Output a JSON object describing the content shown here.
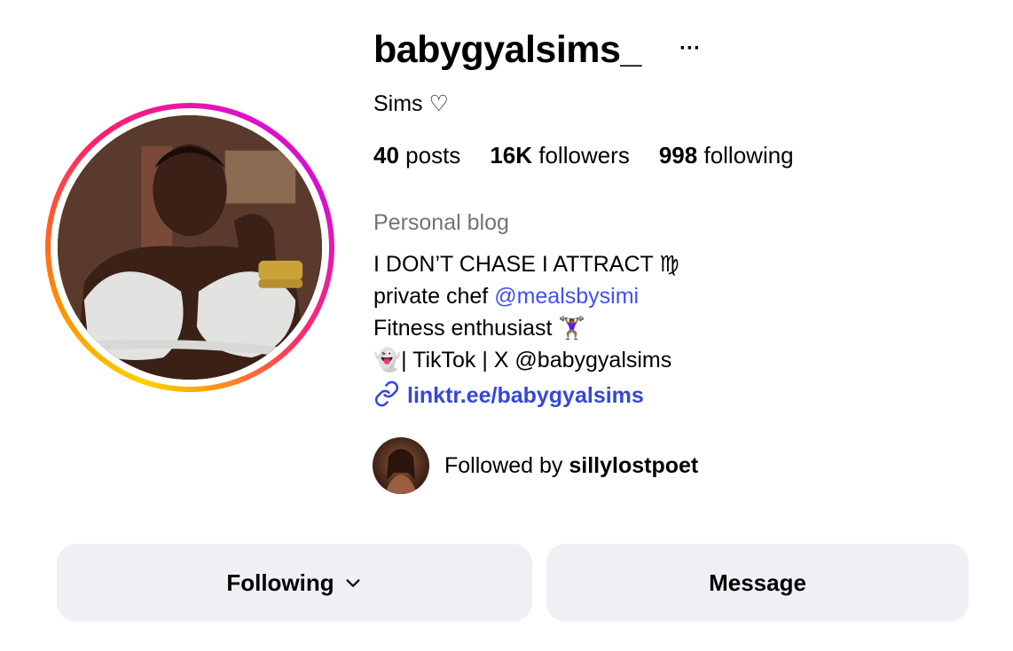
{
  "profile": {
    "username": "babygyalsims_",
    "full_name": "Sims ♡",
    "more_label": "···",
    "stats": {
      "posts_count": "40",
      "posts_label": "posts",
      "followers_count": "16K",
      "followers_label": "followers",
      "following_count": "998",
      "following_label": "following"
    },
    "category": "Personal blog",
    "bio": {
      "line1": "I DON’T CHASE I ATTRACT ♍",
      "line2_prefix": "private chef ",
      "line2_mention": "@mealsbysimi",
      "line3": "Fitness enthusiast 🏋🏾‍♀️",
      "line4": "👻| TikTok | X @babygyalsims"
    },
    "link": "linktr.ee/babygyalsims",
    "followed_by_prefix": "Followed by",
    "followed_by_user": "sillylostpoet"
  },
  "actions": {
    "following_label": "Following",
    "message_label": "Message"
  },
  "icons": {
    "more": "more-options-icon",
    "link": "link-icon",
    "chevron": "chevron-down-icon"
  },
  "colors": {
    "link": "#3547d8",
    "mention": "#4150f7",
    "button_bg": "#eff0f4",
    "muted": "#737373"
  }
}
